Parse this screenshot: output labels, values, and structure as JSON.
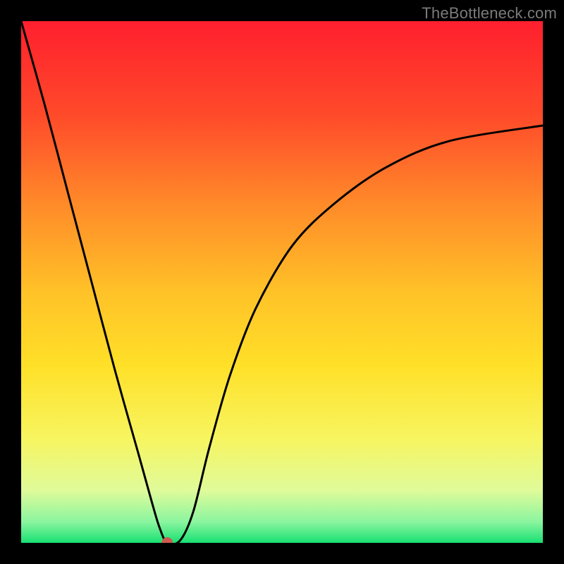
{
  "attribution": "TheBottleneck.com",
  "chart_data": {
    "type": "line",
    "title": "",
    "xlabel": "",
    "ylabel": "",
    "xlim": [
      0,
      100
    ],
    "ylim": [
      0,
      100
    ],
    "x": [
      0,
      4.5,
      9,
      13.5,
      18,
      22.5,
      25,
      26.5,
      28,
      30.5,
      33,
      36,
      40,
      45,
      52,
      60,
      70,
      82,
      100
    ],
    "values": [
      100,
      84,
      67,
      50,
      33,
      17,
      8,
      3,
      0,
      0.5,
      6,
      18,
      32,
      45,
      57,
      65,
      72,
      77,
      80
    ],
    "gradient_stops": [
      {
        "offset": 0.0,
        "color": "#ff1f2e"
      },
      {
        "offset": 0.18,
        "color": "#ff4a2a"
      },
      {
        "offset": 0.35,
        "color": "#ff8a29"
      },
      {
        "offset": 0.52,
        "color": "#ffc228"
      },
      {
        "offset": 0.66,
        "color": "#ffe028"
      },
      {
        "offset": 0.8,
        "color": "#f7f560"
      },
      {
        "offset": 0.9,
        "color": "#dffb9a"
      },
      {
        "offset": 0.96,
        "color": "#8af59f"
      },
      {
        "offset": 1.0,
        "color": "#18e072"
      }
    ],
    "marker": {
      "x": 28,
      "y": 0,
      "color": "#cf5a52",
      "r": 8
    }
  }
}
